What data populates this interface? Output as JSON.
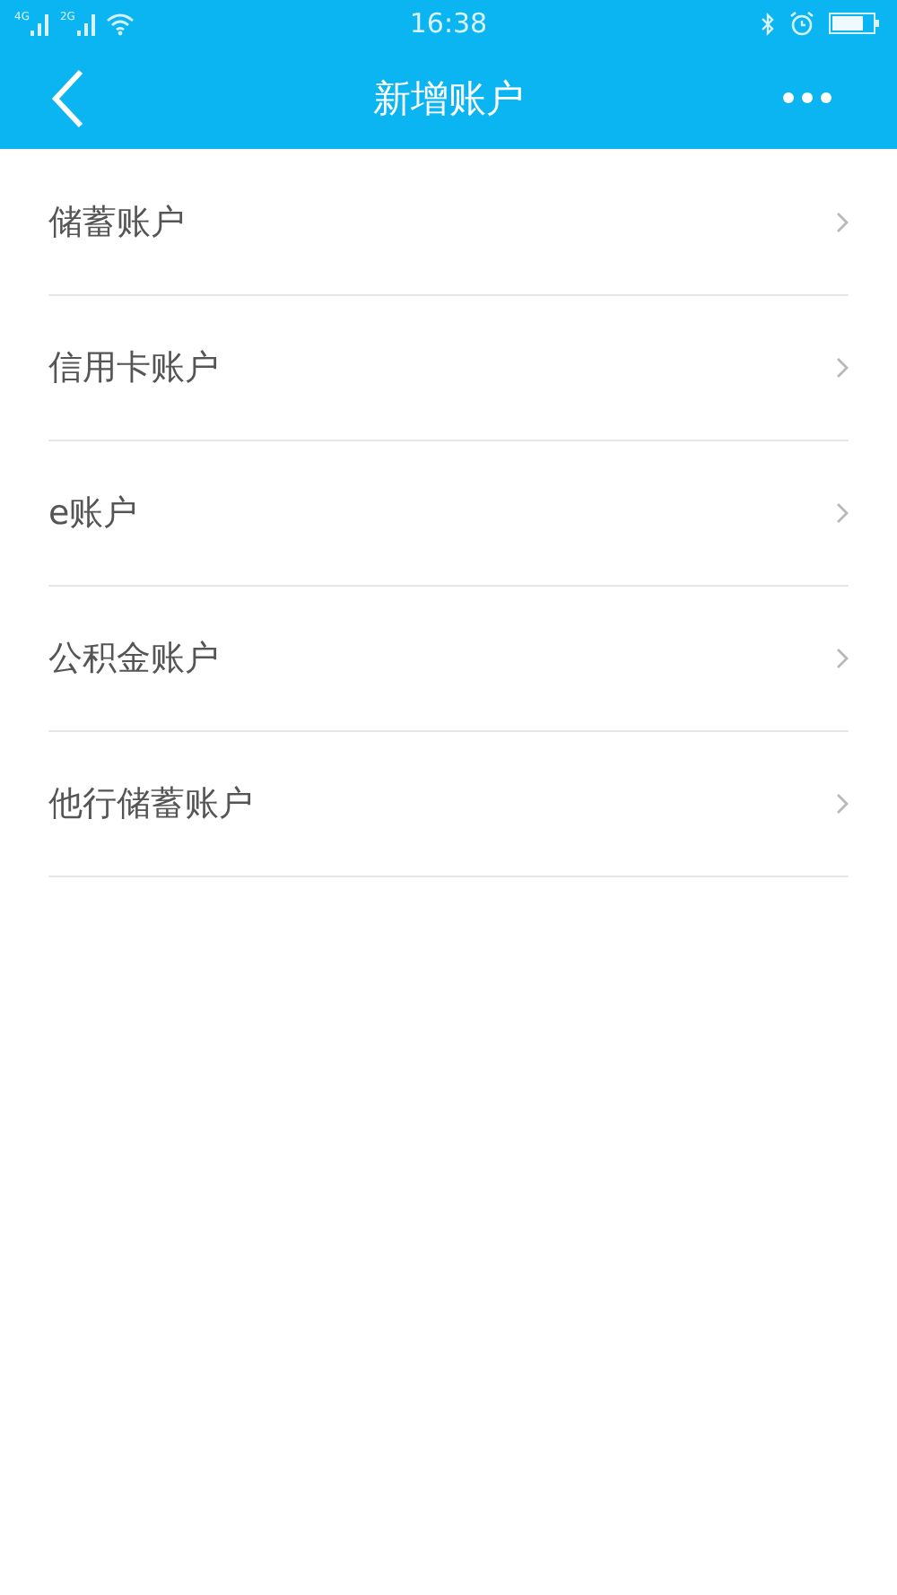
{
  "status_bar": {
    "signals": [
      {
        "network": "4G"
      },
      {
        "network": "2G"
      }
    ],
    "time": "16:38"
  },
  "header": {
    "title": "新增账户"
  },
  "accounts": [
    {
      "label": "储蓄账户"
    },
    {
      "label": "信用卡账户"
    },
    {
      "label": "e账户"
    },
    {
      "label": "公积金账户"
    },
    {
      "label": "他行储蓄账户"
    }
  ]
}
